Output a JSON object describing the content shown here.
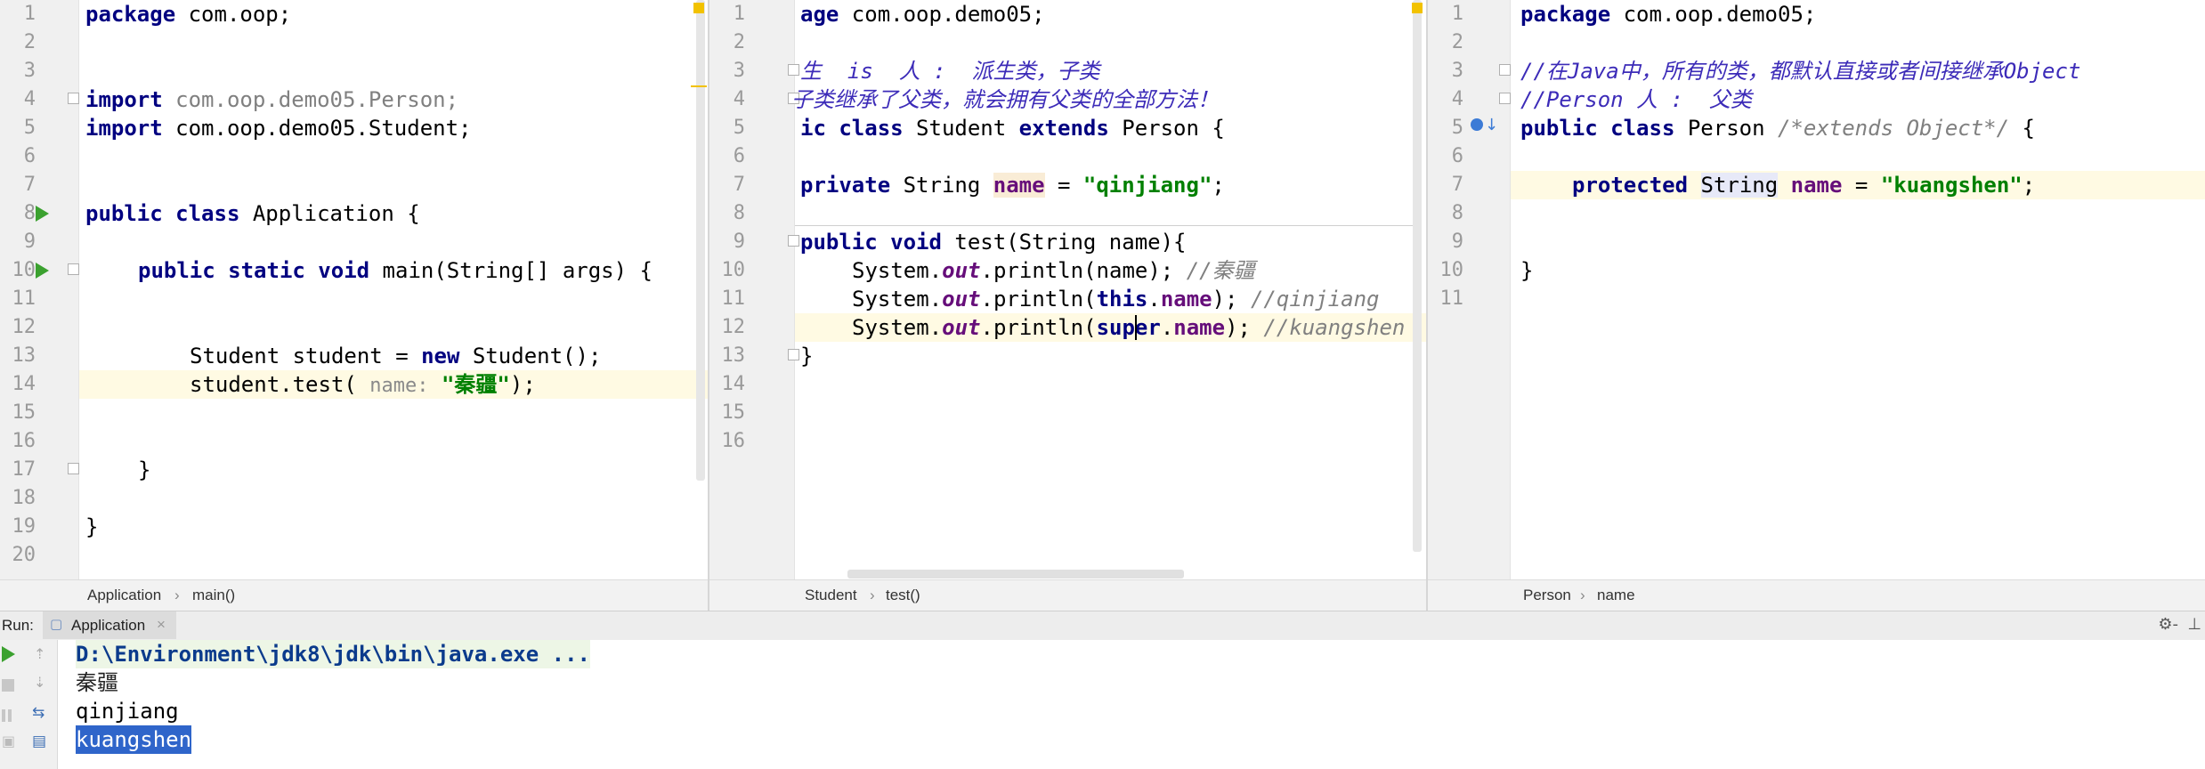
{
  "pane1": {
    "line_numbers": [
      "1",
      "2",
      "3",
      "4",
      "5",
      "6",
      "7",
      "8",
      "9",
      "10",
      "11",
      "12",
      "13",
      "14",
      "15",
      "16",
      "17",
      "18",
      "19",
      "20"
    ],
    "breadcrumb": [
      "Application",
      "main()"
    ],
    "code": {
      "l1_kw": "package",
      "l1_rest": " com.oop;",
      "l4_kw": "import",
      "l4_rest": " com.oop.demo05.Person;",
      "l5_kw": "import",
      "l5_rest": " com.oop.demo05.Student;",
      "l8_kw": "public class",
      "l8_rest": " Application {",
      "l10_kw": "public static void",
      "l10_rest": " main(String[] args) {",
      "l13_a": "Student student = ",
      "l13_kw": "new",
      "l13_b": " Student();",
      "l14_a": "student.test( ",
      "l14_hint": "name:",
      "l14_str": " \"秦疆\"",
      "l14_b": ");",
      "l17": "}",
      "l19": "}"
    }
  },
  "pane2": {
    "line_numbers": [
      "1",
      "2",
      "3",
      "4",
      "5",
      "6",
      "7",
      "8",
      "9",
      "10",
      "11",
      "12",
      "13",
      "14",
      "15",
      "16"
    ],
    "breadcrumb": [
      "Student",
      "test()"
    ],
    "code": {
      "l1_kw": "age",
      "l1_rest": " com.oop.demo05;",
      "l3": "生  is  人 :  派生类，子类",
      "l4": "子类继承了父类，就会拥有父类的全部方法！",
      "l5_kw": "ic class",
      "l5_mid": " Student ",
      "l5_kw2": "extends",
      "l5_rest": " Person {",
      "l7_kw": "private",
      "l7_a": " String ",
      "l7_fld": "name",
      "l7_b": " = ",
      "l7_str": "\"qinjiang\"",
      "l7_c": ";",
      "l9_kw": "public void",
      "l9_rest": " test(String name){",
      "l10_a": "System.",
      "l10_out": "out",
      "l10_b": ".println(name); ",
      "l10_cmt": "//秦疆",
      "l11_a": "System.",
      "l11_out": "out",
      "l11_b": ".println(",
      "l11_kw": "this",
      "l11_c": ".",
      "l11_fld": "name",
      "l11_d": "); ",
      "l11_cmt": "//qinjiang",
      "l12_a": "System.",
      "l12_out": "out",
      "l12_b": ".println(",
      "l12_kw": "super",
      "l12_c": ".",
      "l12_fld": "name",
      "l12_d": "); ",
      "l12_cmt": "//kuangshen",
      "l13": "}"
    }
  },
  "pane3": {
    "line_numbers": [
      "1",
      "2",
      "3",
      "4",
      "5",
      "6",
      "7",
      "8",
      "9",
      "10",
      "11"
    ],
    "breadcrumb": [
      "Person",
      "name"
    ],
    "code": {
      "l1_kw": "package",
      "l1_rest": " com.oop.demo05;",
      "l3": "//在Java中，所有的类，都默认直接或者间接继承Object",
      "l4": "//Person 人 :  父类",
      "l5_kw": "public class",
      "l5_mid": " Person ",
      "l5_cmt": "/*extends Object*/",
      "l5_rest": " {",
      "l7_kw": "protected",
      "l7_sp": " ",
      "l7_type": "String",
      "l7_sp2": " ",
      "l7_fld": "name",
      "l7_b": " = ",
      "l7_str": "\"kuangshen\"",
      "l7_c": ";",
      "l10": "}"
    }
  },
  "run": {
    "label": "Run:",
    "tab": "Application",
    "close": "×",
    "settings": "⚙-",
    "hide": "⊥"
  },
  "console": {
    "lines": [
      "D:\\Environment\\jdk8\\jdk\\bin\\java.exe ...",
      "秦疆",
      "qinjiang",
      "kuangshen"
    ]
  },
  "colors": {
    "keyword": "#000080",
    "string": "#008000",
    "field": "#660e7a",
    "comment": "#808080",
    "doc_comment": "#3c2bb8",
    "current_line": "#fffae3",
    "run_green": "#3ba12f",
    "selection": "#2f65ca"
  }
}
